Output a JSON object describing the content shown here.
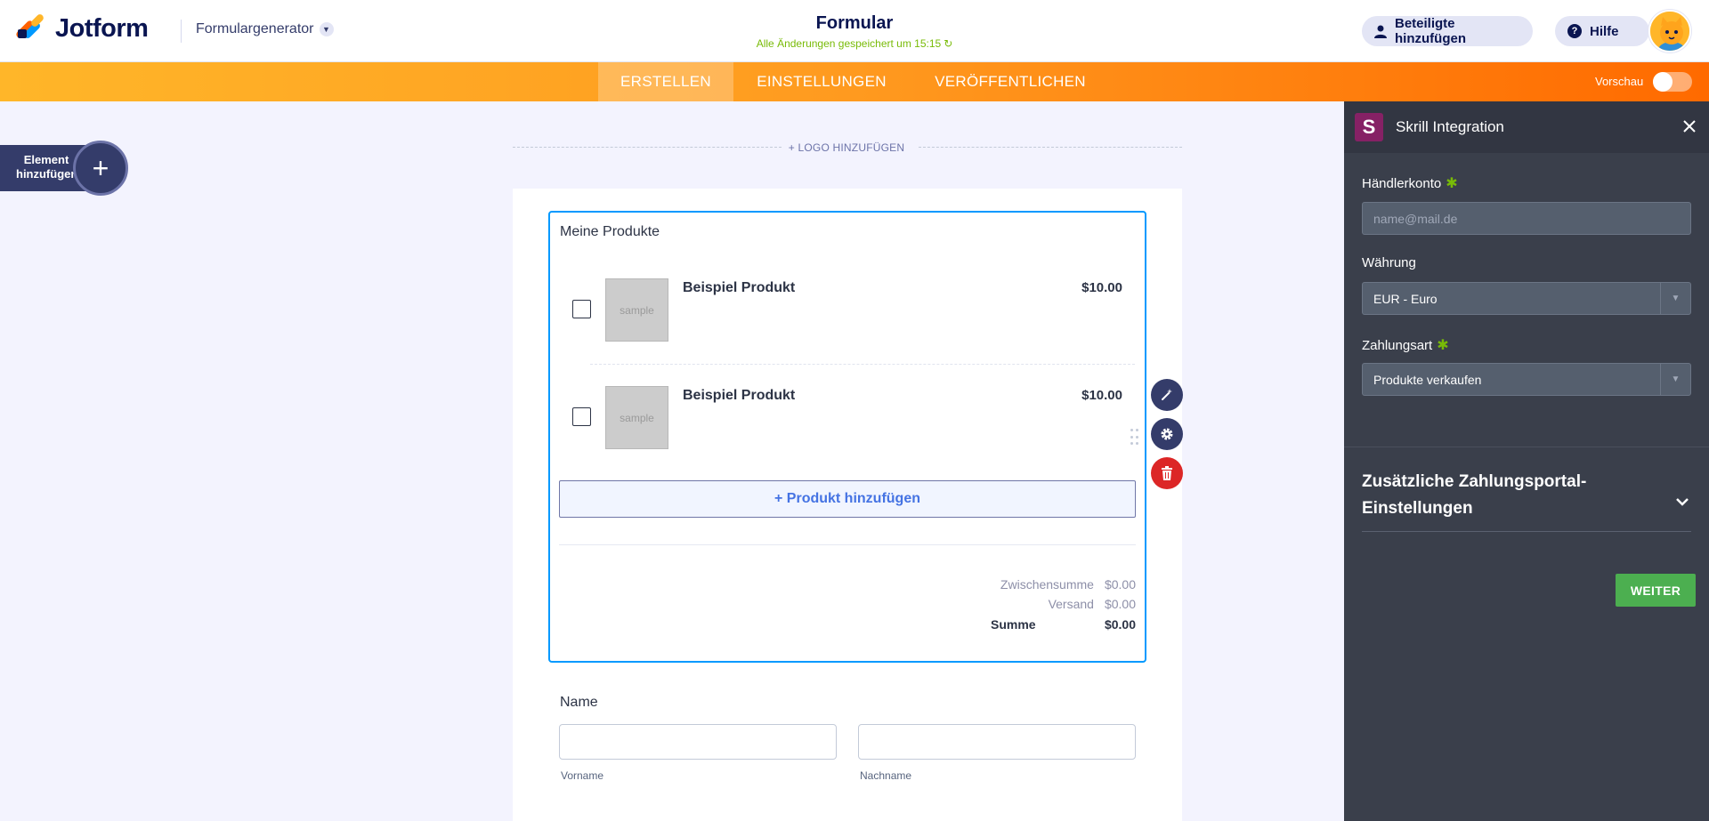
{
  "header": {
    "logo_text": "Jotform",
    "builder_label": "Formulargenerator",
    "form_title": "Formular",
    "saved_status": "Alle Änderungen gespeichert um 15:15",
    "add_participants_label": "Beteiligte hinzufügen",
    "help_label": "Hilfe"
  },
  "nav": {
    "tabs": [
      {
        "label": "ERSTELLEN",
        "active": true
      },
      {
        "label": "EINSTELLUNGEN",
        "active": false
      },
      {
        "label": "VERÖFFENTLICHEN",
        "active": false
      }
    ],
    "preview_label": "Vorschau",
    "preview_enabled": false
  },
  "sidebar_left": {
    "add_element_label_line1": "Element",
    "add_element_label_line2": "hinzufügen"
  },
  "canvas": {
    "add_logo_label": "+ LOGO HINZUFÜGEN",
    "product_field": {
      "label": "Meine Produkte",
      "products": [
        {
          "name": "Beispiel Produkt",
          "price": "$10.00",
          "image_text": "sample"
        },
        {
          "name": "Beispiel Produkt",
          "price": "$10.00",
          "image_text": "sample"
        }
      ],
      "add_product_label": "+ Produkt hinzufügen",
      "subtotal_label": "Zwischensumme",
      "subtotal_value": "$0.00",
      "shipping_label": "Versand",
      "shipping_value": "$0.00",
      "total_label": "Summe",
      "total_value": "$0.00"
    },
    "name_field": {
      "label": "Name",
      "first_sublabel": "Vorname",
      "last_sublabel": "Nachname"
    }
  },
  "panel": {
    "logo_letter": "S",
    "title": "Skrill Integration",
    "merchant_label": "Händlerkonto",
    "merchant_placeholder": "name@mail.de",
    "currency_label": "Währung",
    "currency_value": "EUR - Euro",
    "payment_type_label": "Zahlungsart",
    "payment_type_value": "Produkte verkaufen",
    "additional_settings_label": "Zusätzliche Zahlungsportal-Einstellungen",
    "next_label": "WEITER"
  },
  "colors": {
    "accent_orange": "#ff6100",
    "selection_blue": "#0099ff",
    "required_green": "#78bb07",
    "delete_red": "#dc2626",
    "next_green": "#4caf50",
    "skrill_purple": "#862165"
  }
}
